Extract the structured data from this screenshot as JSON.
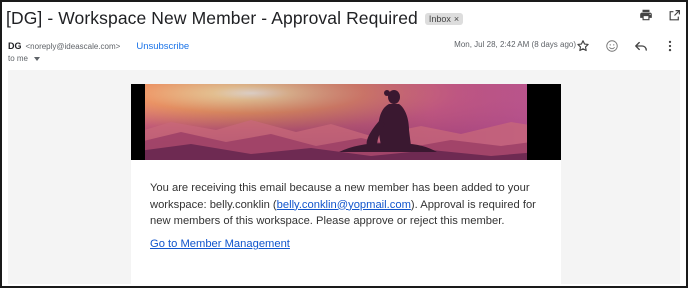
{
  "email": {
    "subject": "[DG] - Workspace New Member - Approval Required",
    "label_chip": "Inbox",
    "label_chip_close": "×",
    "sender_name": "DG",
    "sender_email": "<noreply@ideascale.com>",
    "unsubscribe_label": "Unsubscribe",
    "date": "Mon, Jul 28, 2:42 AM (8 days ago)",
    "recipient_label": "to me"
  },
  "icons": {
    "print": "print-icon",
    "open_new_window": "open-in-new-window-icon",
    "star": "star-icon",
    "emoji": "emoji-reaction-icon",
    "reply": "reply-icon",
    "more": "more-vertical-icon",
    "recipient_details": "chevron-down-icon"
  },
  "message": {
    "paragraph_part1": "You are receiving this email because a new member has been added to your workspace: belly.conklin (",
    "member_email": "belly.conklin@yopmail.com",
    "paragraph_part2": "). Approval is required for new members of this workspace. Please approve or reject this member.",
    "action_link": "Go to Member Management"
  },
  "colors": {
    "link": "#1155cc",
    "unsubscribe": "#1a73e8",
    "email_background": "#f4f4f4"
  }
}
